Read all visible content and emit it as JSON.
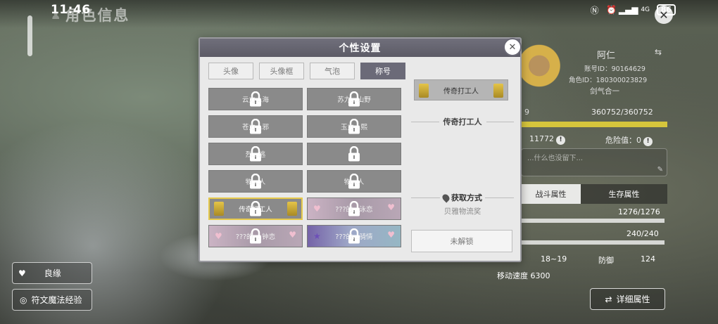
{
  "status_bar": {
    "time": "11:46",
    "battery": "86",
    "icons": [
      "nfc-icon",
      "alarm-icon",
      "signal-icon",
      "4g-icon",
      "battery-icon"
    ]
  },
  "page": {
    "title": "角色信息"
  },
  "left_buttons": {
    "fate": "良缘",
    "rune_exp": "符文魔法经验"
  },
  "character": {
    "name": "阿仁",
    "account_id": "账号ID：90164629",
    "role_id": "角色ID：180300023829",
    "guild": "剑气合一",
    "level": "9",
    "hp_total": "360752/360752",
    "gold": "11772",
    "danger": "危险值：0",
    "signature_placeholder": "...什么也没留下...",
    "tab_battle": "战斗属性",
    "tab_survival": "生存属性",
    "stat_a": "1276/1276",
    "stat_b": "240/240",
    "atk_range": "18~19",
    "defense_label": "防御",
    "defense_value": "124",
    "speed": "移动速度  6300",
    "detail_button": "详细属性"
  },
  "modal": {
    "title": "个性设置",
    "tabs": [
      {
        "label": "头像",
        "active": false
      },
      {
        "label": "头像框",
        "active": false
      },
      {
        "label": "气泡",
        "active": false
      },
      {
        "label": "称号",
        "active": true
      }
    ],
    "titles": [
      {
        "label": "云力…海",
        "style": "plain",
        "locked": true
      },
      {
        "label": "苏力…山野",
        "style": "plain",
        "locked": true
      },
      {
        "label": "苍力…邪",
        "style": "plain",
        "locked": true
      },
      {
        "label": "玉力…熙",
        "style": "plain",
        "locked": true
      },
      {
        "label": "烈…逃",
        "style": "plain",
        "locked": true
      },
      {
        "label": "",
        "style": "plain",
        "locked": true
      },
      {
        "label": "物…人",
        "style": "plain",
        "locked": true
      },
      {
        "label": "物…人",
        "style": "plain",
        "locked": true
      },
      {
        "label": "传奇打工人",
        "style": "gold",
        "locked": true
      },
      {
        "label": "???的…泳恋",
        "style": "pink",
        "locked": true
      },
      {
        "label": "???的…·钟恋",
        "style": "pink",
        "locked": true
      },
      {
        "label": "???的…骑情",
        "style": "purple",
        "locked": true
      }
    ],
    "preview_badge": "传奇打工人",
    "selected_title": "传奇打工人",
    "how_label": "获取方式",
    "how_text": "贝雅物流奖",
    "unlock_button": "未解锁"
  }
}
